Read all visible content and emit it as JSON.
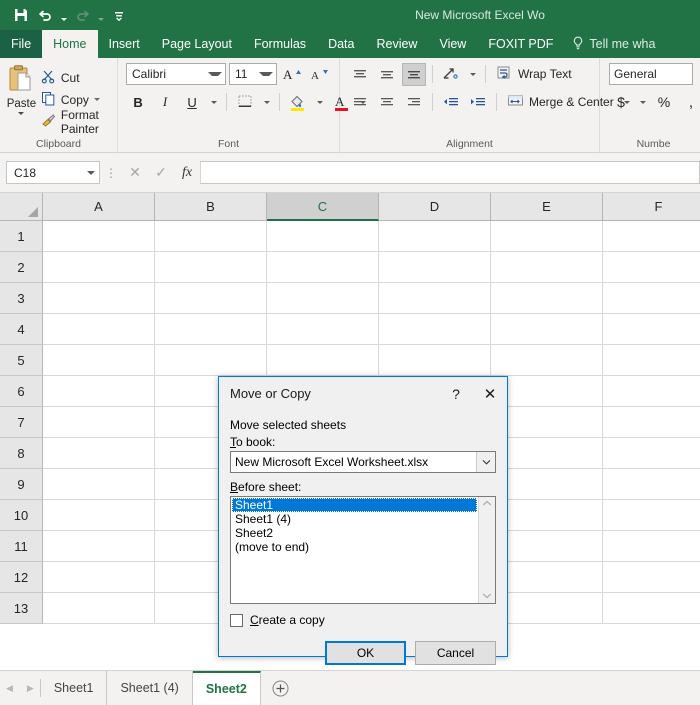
{
  "window": {
    "title": "New Microsoft Excel Wo",
    "accent_color": "#217346",
    "quick_access": [
      {
        "name": "save",
        "icon": "save-icon"
      },
      {
        "name": "undo",
        "icon": "undo-icon"
      },
      {
        "name": "redo",
        "icon": "redo-icon"
      },
      {
        "name": "customize",
        "icon": "customize-quick-access-icon"
      }
    ]
  },
  "ribbon": {
    "tabs": [
      {
        "label": "File",
        "active": false
      },
      {
        "label": "Home",
        "active": true
      },
      {
        "label": "Insert",
        "active": false
      },
      {
        "label": "Page Layout",
        "active": false
      },
      {
        "label": "Formulas",
        "active": false
      },
      {
        "label": "Data",
        "active": false
      },
      {
        "label": "Review",
        "active": false
      },
      {
        "label": "View",
        "active": false
      },
      {
        "label": "FOXIT PDF",
        "active": false
      }
    ],
    "tell_me": "Tell me wha",
    "groups": {
      "clipboard": {
        "label": "Clipboard",
        "paste": "Paste",
        "cut": "Cut",
        "copy": "Copy",
        "format_painter": "Format Painter"
      },
      "font": {
        "label": "Font",
        "font_name": "Calibri",
        "font_size": "11",
        "bold": "B",
        "italic": "I",
        "underline": "U"
      },
      "alignment": {
        "label": "Alignment",
        "wrap_text": "Wrap Text",
        "merge_center": "Merge & Center"
      },
      "number": {
        "label": "Numbe",
        "format": "General",
        "currency": "$",
        "percent": "%",
        "comma": ","
      }
    }
  },
  "formula_bar": {
    "name_box": "C18",
    "cancel": "✕",
    "enter": "✓",
    "insert_function": "fx",
    "value": ""
  },
  "grid": {
    "columns": [
      "A",
      "B",
      "C",
      "D",
      "E",
      "F"
    ],
    "selected_column": "C",
    "rows": [
      "1",
      "2",
      "3",
      "4",
      "5",
      "6",
      "7",
      "8",
      "9",
      "10",
      "11",
      "12",
      "13"
    ]
  },
  "sheet_tabs": {
    "tabs": [
      {
        "label": "Sheet1",
        "active": false
      },
      {
        "label": "Sheet1 (4)",
        "active": false
      },
      {
        "label": "Sheet2",
        "active": true
      }
    ],
    "add_sheet": "+"
  },
  "dialog": {
    "title": "Move or Copy",
    "help": "?",
    "close": "✕",
    "description": "Move selected sheets",
    "to_book_label": "To book:",
    "to_book_value": "New Microsoft Excel Worksheet.xlsx",
    "before_sheet_label": "Before sheet:",
    "sheet_list": [
      "Sheet1",
      "Sheet1 (4)",
      "Sheet2",
      "(move to end)"
    ],
    "selected_sheet": "Sheet1",
    "create_copy_label": "Create a copy",
    "create_copy_checked": false,
    "ok": "OK",
    "cancel": "Cancel",
    "accent_color": "#0078d7"
  }
}
